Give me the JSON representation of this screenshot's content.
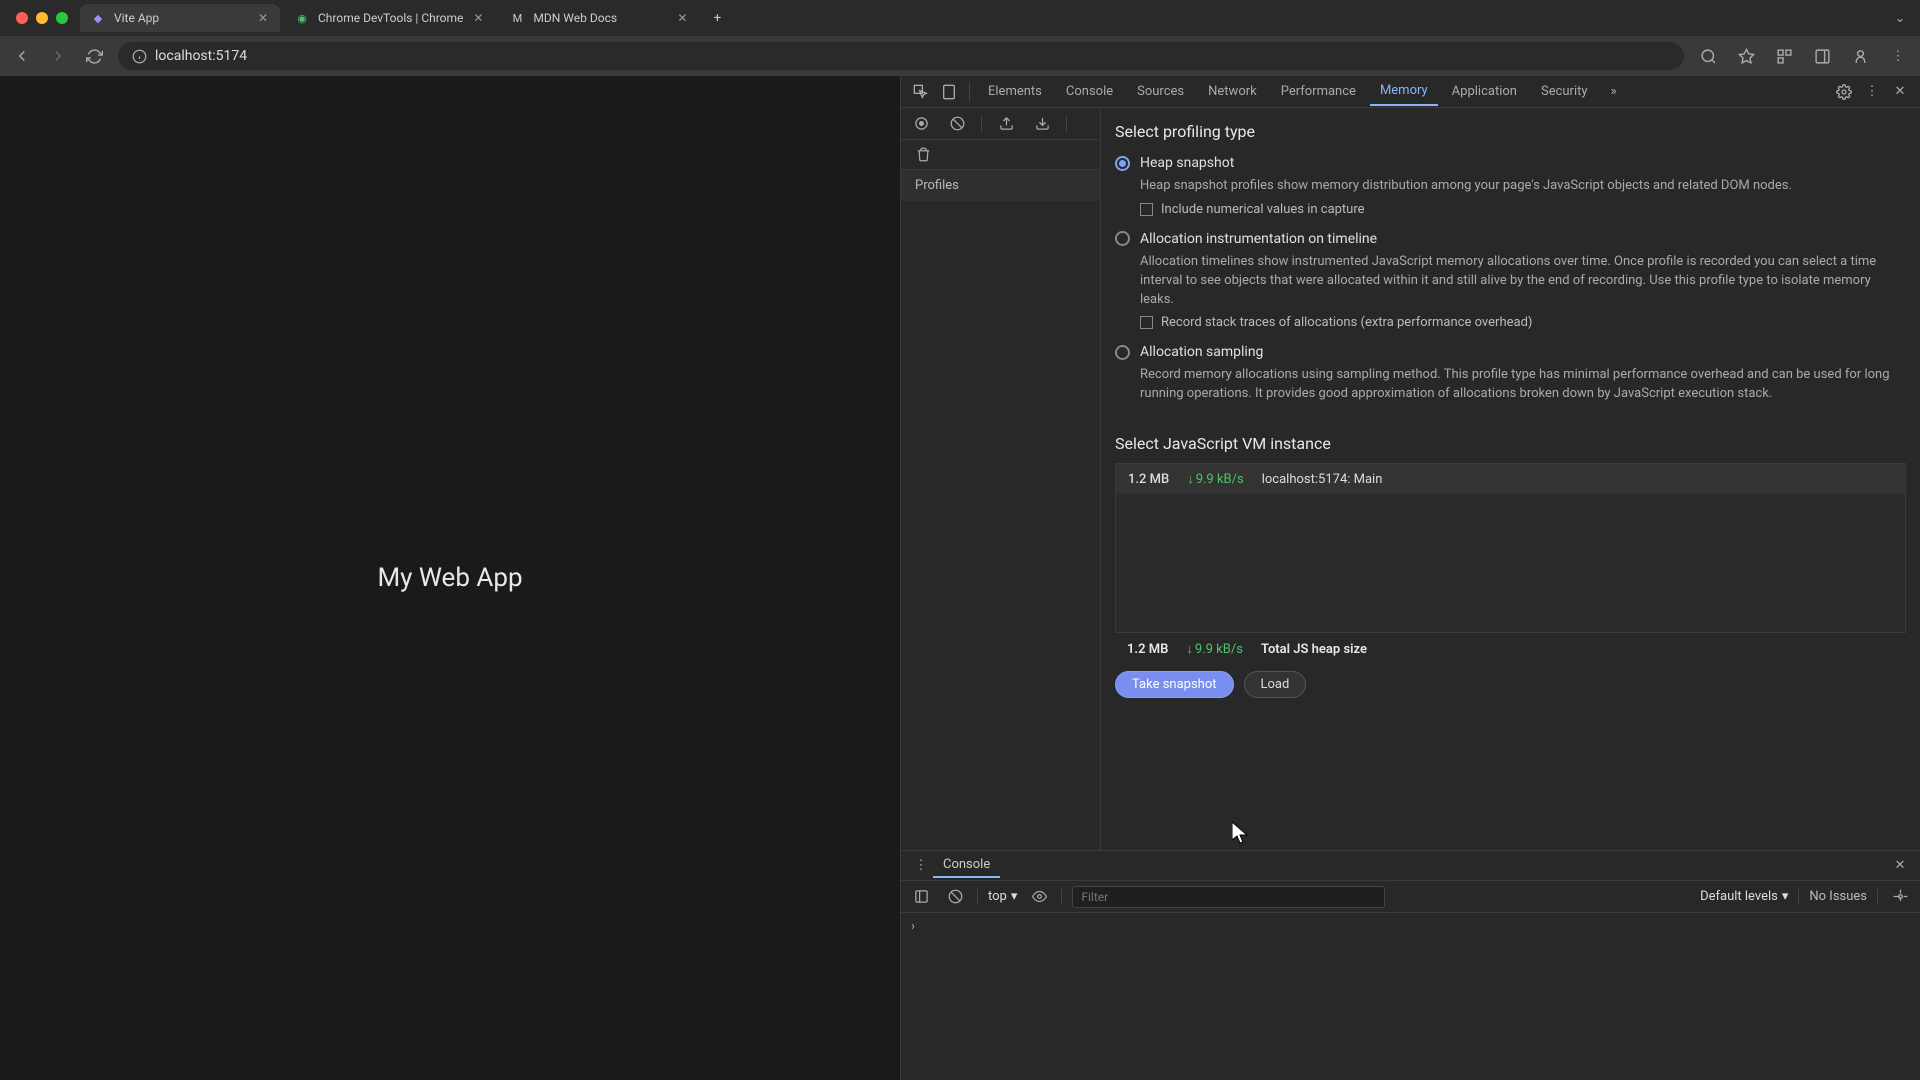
{
  "tabs": [
    {
      "title": "Vite App",
      "favicon": "⚡"
    },
    {
      "title": "Chrome DevTools | Chrome",
      "favicon": "◉"
    },
    {
      "title": "MDN Web Docs",
      "favicon": "M"
    }
  ],
  "address": "localhost:5174",
  "page": {
    "heading": "My Web App"
  },
  "devtools": {
    "tabs": [
      "Elements",
      "Console",
      "Sources",
      "Network",
      "Performance",
      "Memory",
      "Application",
      "Security"
    ],
    "active_tab": "Memory",
    "sidebar": {
      "profiles_label": "Profiles"
    },
    "memory": {
      "section_title": "Select profiling type",
      "options": [
        {
          "label": "Heap snapshot",
          "desc": "Heap snapshot profiles show memory distribution among your page's JavaScript objects and related DOM nodes.",
          "checkbox": "Include numerical values in capture",
          "selected": true
        },
        {
          "label": "Allocation instrumentation on timeline",
          "desc": "Allocation timelines show instrumented JavaScript memory allocations over time. Once profile is recorded you can select a time interval to see objects that were allocated within it and still alive by the end of recording. Use this profile type to isolate memory leaks.",
          "checkbox": "Record stack traces of allocations (extra performance overhead)",
          "selected": false
        },
        {
          "label": "Allocation sampling",
          "desc": "Record memory allocations using sampling method. This profile type has minimal performance overhead and can be used for long running operations. It provides good approximation of allocations broken down by JavaScript execution stack.",
          "selected": false
        }
      ],
      "vm_title": "Select JavaScript VM instance",
      "vm_row": {
        "size": "1.2 MB",
        "rate": "9.9 kB/s",
        "name": "localhost:5174: Main"
      },
      "vm_total": {
        "size": "1.2 MB",
        "rate": "9.9 kB/s",
        "label": "Total JS heap size"
      },
      "take_snapshot": "Take snapshot",
      "load": "Load"
    }
  },
  "console": {
    "tab_label": "Console",
    "context": "top",
    "filter_placeholder": "Filter",
    "levels": "Default levels",
    "issues": "No Issues"
  }
}
